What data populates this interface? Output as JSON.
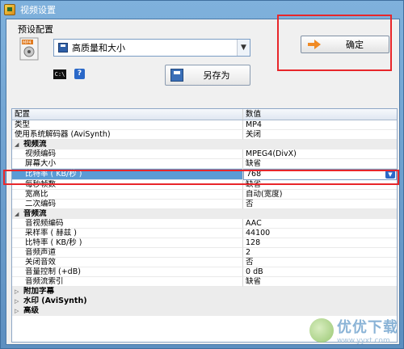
{
  "window": {
    "title": "视频设置"
  },
  "preset": {
    "label": "预设配置",
    "selected": "高质量和大小",
    "save_as_label": "另存为",
    "ok_label": "确定"
  },
  "grid": {
    "header": {
      "name": "配置",
      "value": "数值"
    },
    "top_rows": [
      {
        "name": "类型",
        "value": "MP4"
      },
      {
        "name": "使用系统解码器 (AviSynth)",
        "value": "关闭"
      }
    ],
    "video_group": {
      "label": "视频流",
      "rows": [
        {
          "name": "视频编码",
          "value": "MPEG4(DivX)"
        },
        {
          "name": "屏幕大小",
          "value": "缺省"
        }
      ],
      "selected_row": {
        "name": "比特率 ( KB/秒 )",
        "value": "768"
      },
      "rows_after": [
        {
          "name": "每秒帧数",
          "value": "缺省"
        },
        {
          "name": "宽高比",
          "value": "自动(宽度)"
        },
        {
          "name": "二次编码",
          "value": "否"
        }
      ]
    },
    "audio_group": {
      "label": "音频流",
      "rows": [
        {
          "name": "音视频编码",
          "value": "AAC"
        },
        {
          "name": "采样率 ( 赫兹 )",
          "value": "44100"
        },
        {
          "name": "比特率 ( KB/秒 )",
          "value": "128"
        },
        {
          "name": "音频声道",
          "value": "2"
        },
        {
          "name": "关闭音效",
          "value": "否"
        },
        {
          "name": "音量控制 (+dB)",
          "value": "0 dB"
        },
        {
          "name": "音频流索引",
          "value": "缺省"
        }
      ]
    },
    "collapsed_groups": [
      "附加字幕",
      "水印 (AviSynth)",
      "高级"
    ]
  },
  "watermark": {
    "text": "优优下载",
    "url": "www.yyxt.com"
  }
}
